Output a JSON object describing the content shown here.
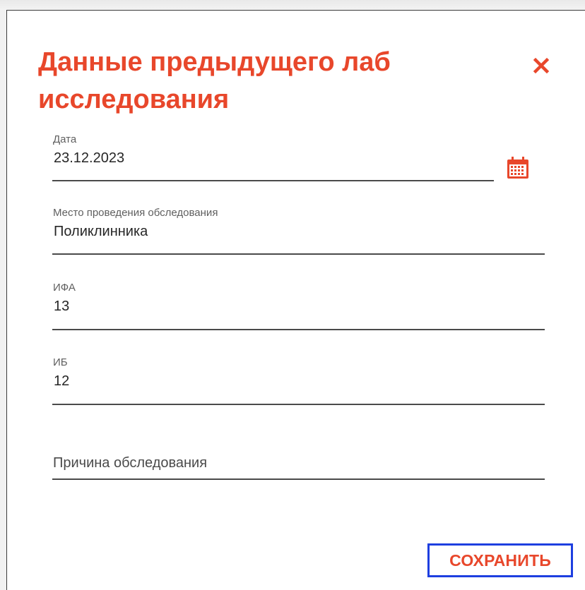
{
  "dialog": {
    "title": "Данные предыдущего лаб исследования",
    "close_icon": "close-icon",
    "accent_color": "#e8472b"
  },
  "fields": {
    "date": {
      "label": "Дата",
      "value": "23.12.2023",
      "icon": "calendar-icon"
    },
    "place": {
      "label": "Место проведения обследования",
      "value": "Поликлинника"
    },
    "ifa": {
      "label": "ИФА",
      "value": "13"
    },
    "ib": {
      "label": "ИБ",
      "value": "12"
    },
    "reason": {
      "placeholder": "Причина обследования",
      "value": ""
    }
  },
  "actions": {
    "save_label": "СОХРАНИТЬ",
    "highlight_color": "#1e3fe0"
  }
}
